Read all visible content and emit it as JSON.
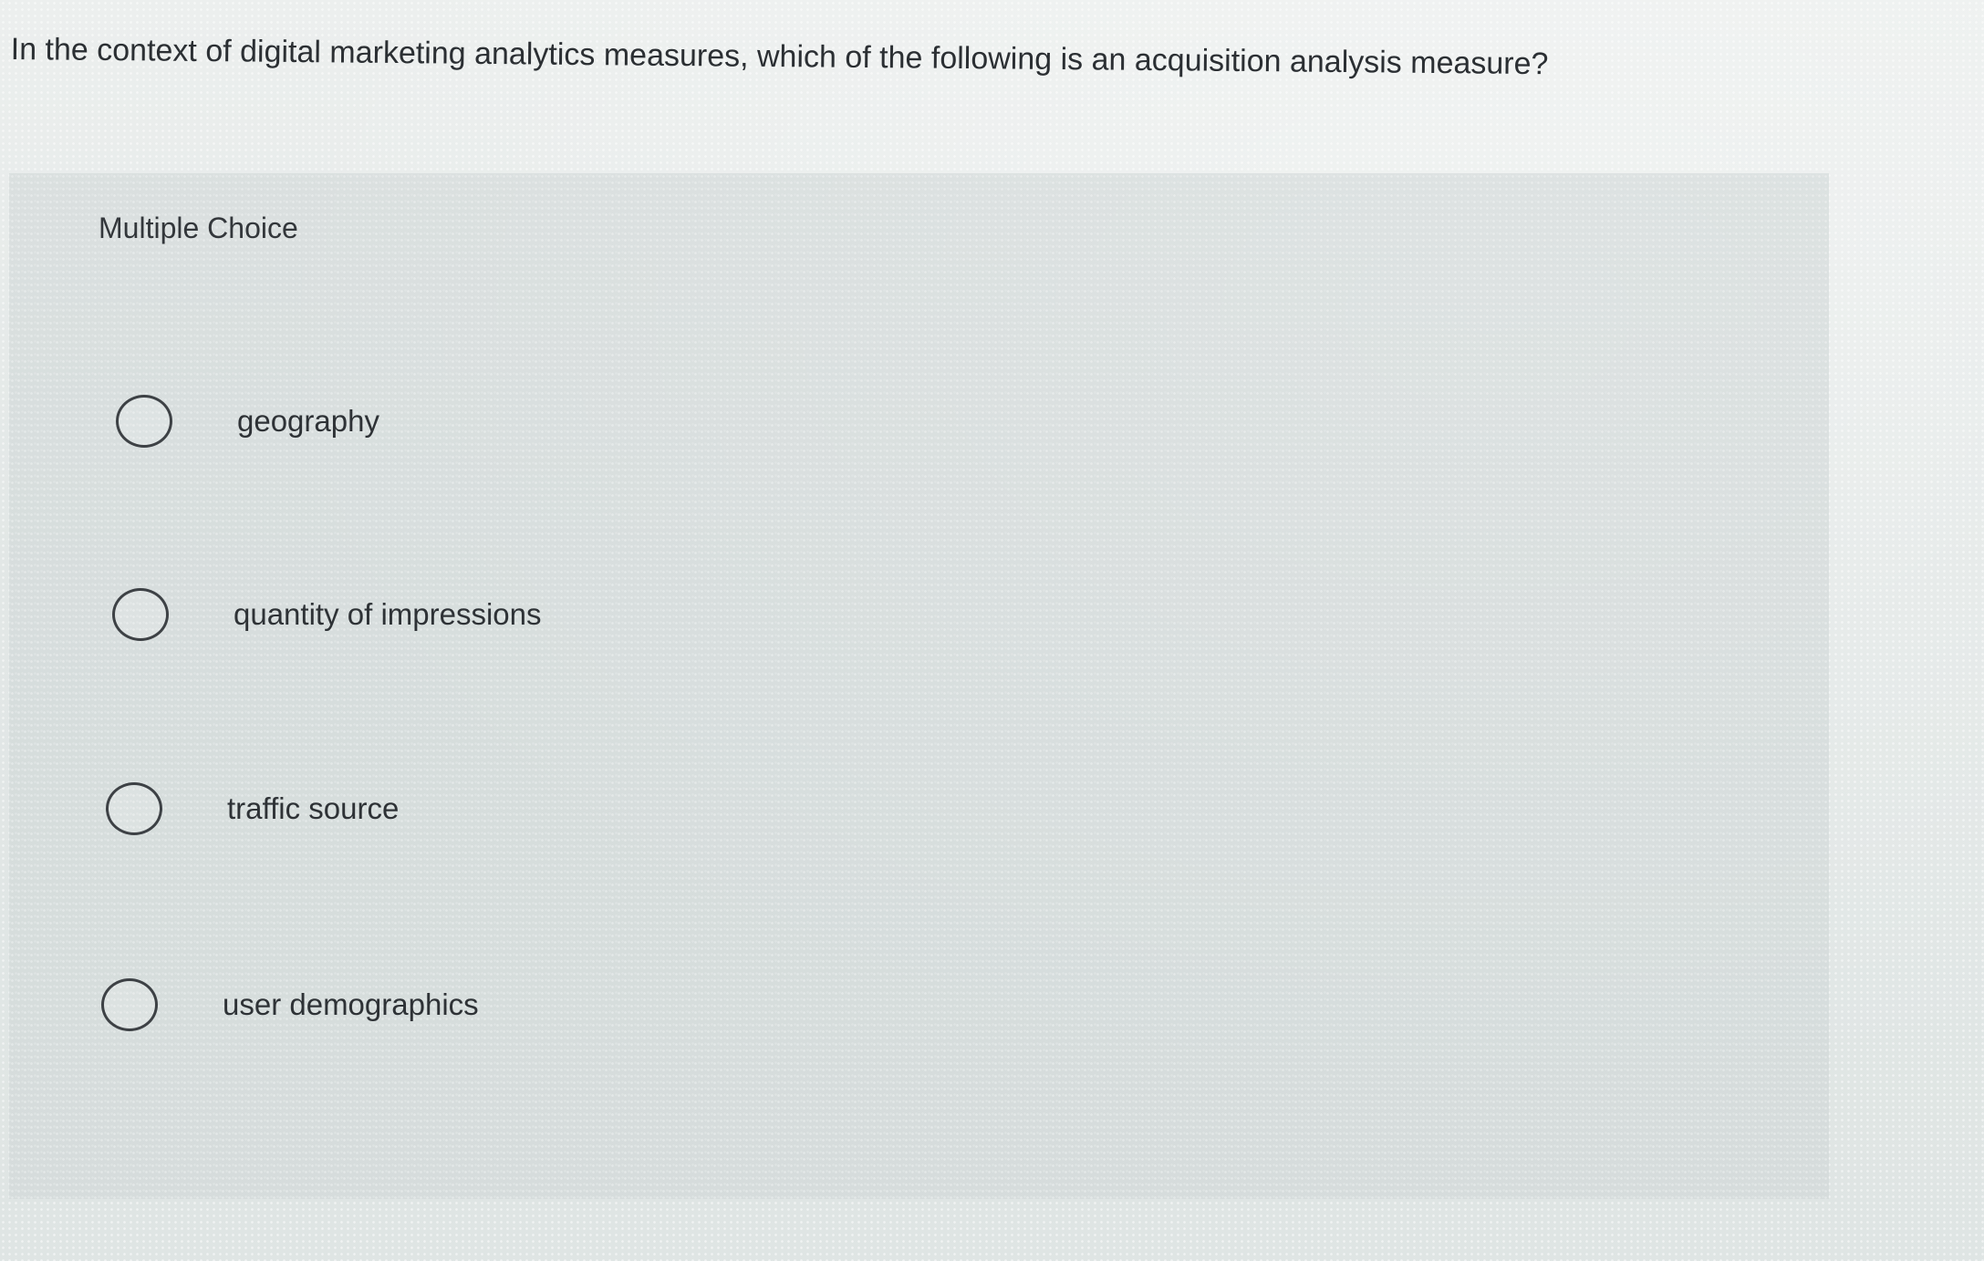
{
  "question": {
    "text": "In the context of digital marketing analytics measures, which of the following is an acquisition analysis measure?"
  },
  "multiple_choice": {
    "title": "Multiple Choice",
    "options": [
      {
        "label": "geography",
        "selected": false
      },
      {
        "label": "quantity of impressions",
        "selected": false
      },
      {
        "label": "traffic source",
        "selected": false
      },
      {
        "label": "user demographics",
        "selected": false
      }
    ]
  },
  "colors": {
    "text": "#2e3236",
    "radio_border": "#3d4145",
    "background": "#e4e8e7"
  },
  "icons": {
    "radio": "radio-button-unchecked-icon"
  }
}
